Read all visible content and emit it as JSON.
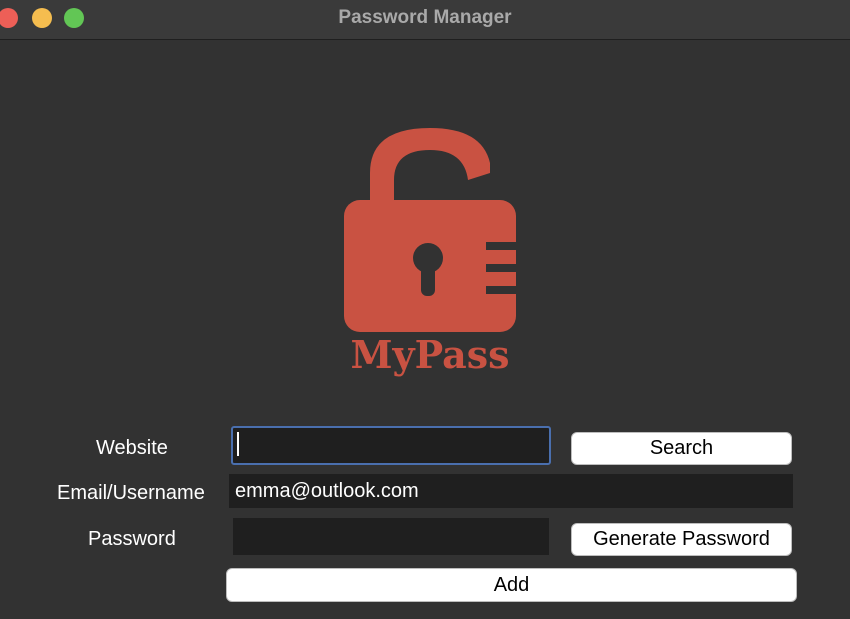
{
  "window": {
    "title": "Password Manager"
  },
  "logo": {
    "text": "MyPass",
    "color": "#c95242"
  },
  "form": {
    "website_label": "Website",
    "website_value": "",
    "email_label": "Email/Username",
    "email_value": "emma@outlook.com",
    "password_label": "Password",
    "password_value": "",
    "search_label": "Search",
    "generate_label": "Generate Password",
    "add_label": "Add"
  },
  "colors": {
    "background": "#323232",
    "field": "#1f1f1f",
    "focus": "#4a6fae"
  }
}
